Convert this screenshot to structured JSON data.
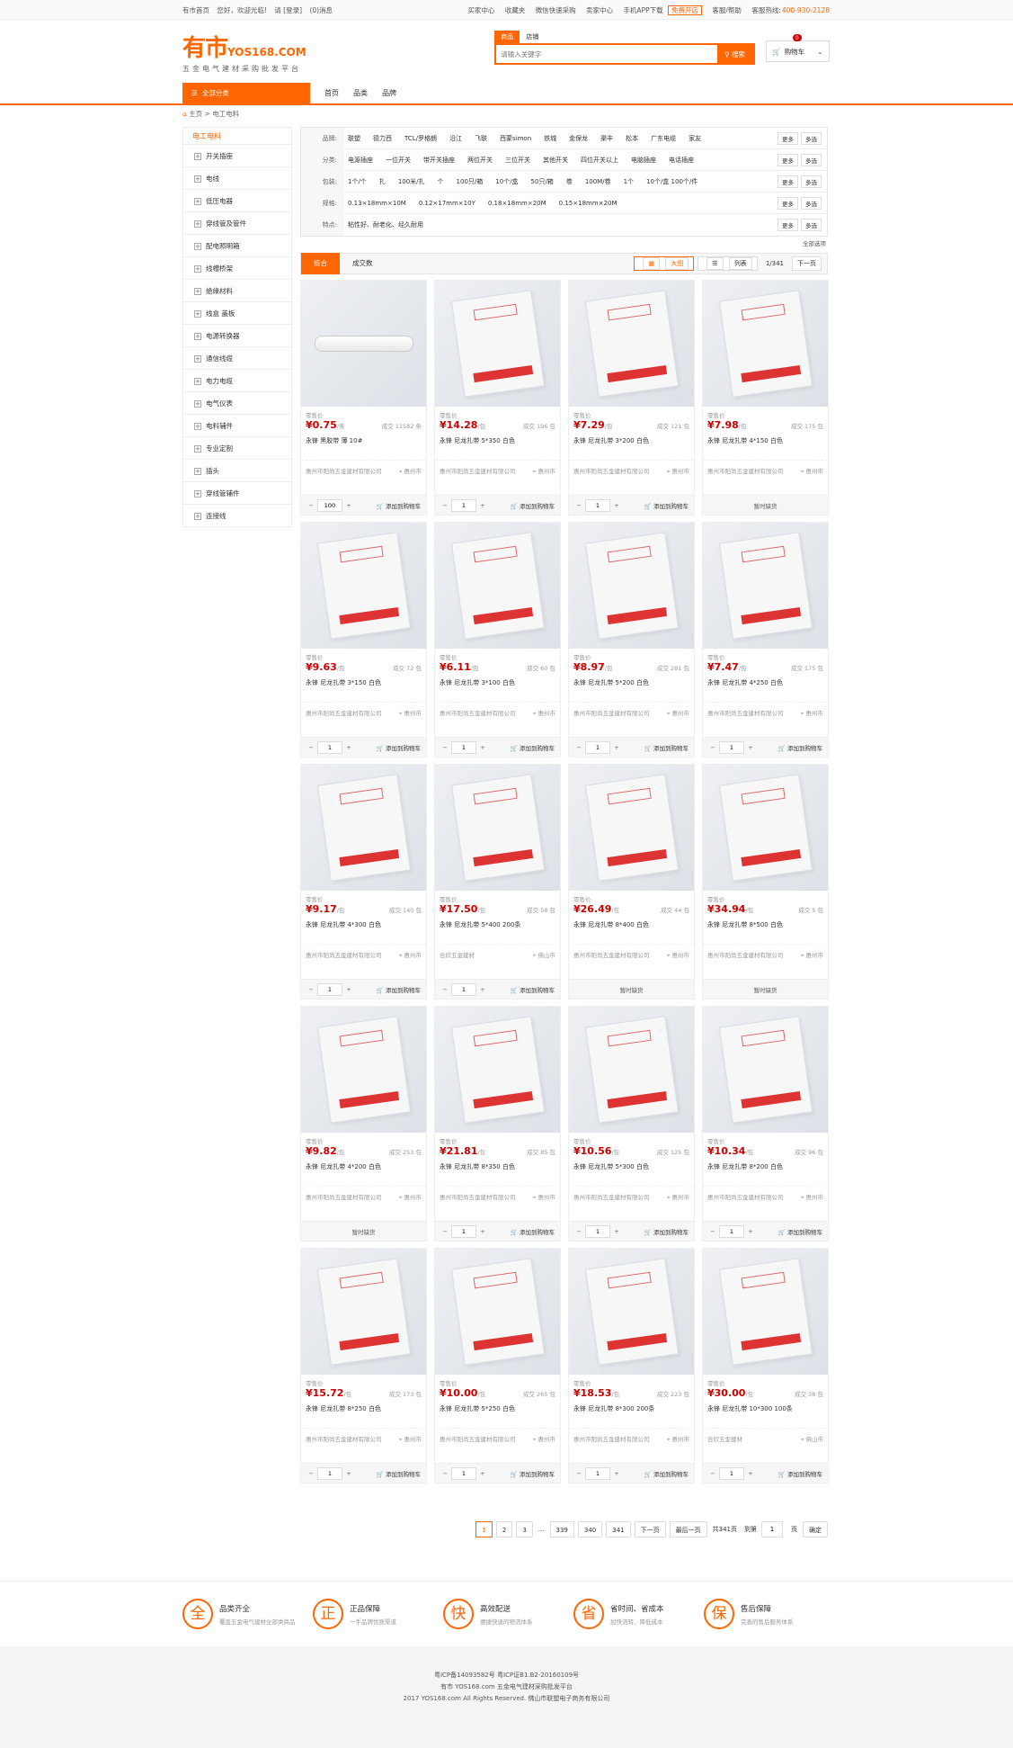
{
  "topbar": {
    "home": "有市首页",
    "welcome": "您好，欢迎光临!",
    "login": "请 [登录]",
    "msg": "(0)消息",
    "buyer": "买家中心",
    "fav": "收藏夹",
    "wechat": "微信快速采购",
    "seller": "卖家中心",
    "app": "手机APP下载",
    "open": "免费开店",
    "help": "客服/帮助",
    "hotline_label": "客服热线:",
    "hotline": "400-930-2128"
  },
  "logo": {
    "cn": "有市",
    "en": "YOS168.COM",
    "slogan": "五金电气建材采购批发平台"
  },
  "search": {
    "tab1": "商品",
    "tab2": "店铺",
    "placeholder": "请输入关键字",
    "button": "搜索"
  },
  "cart": {
    "count": "0",
    "label": "购物车"
  },
  "nav": {
    "all": "全部分类",
    "home": "首页",
    "cat": "品类",
    "brand": "品牌"
  },
  "crumb": "主页 > 电工电料",
  "side": {
    "title": "电工电料",
    "items": [
      "开关插座",
      "电线",
      "低压电器",
      "穿线管及管件",
      "配电照明箱",
      "线槽桥架",
      "绝缘材料",
      "线盒 盖板",
      "电源转换器",
      "通信线缆",
      "电力电缆",
      "电气仪表",
      "电料辅件",
      "专业定制",
      "插头",
      "穿线管辅件",
      "连接线"
    ]
  },
  "filters": [
    {
      "k": "品牌:",
      "v": [
        "联塑",
        "德力西",
        "TCL/罗格朗",
        "沿江",
        "飞联",
        "西蒙simon",
        "铁城",
        "金保龙",
        "渠丰",
        "松本",
        "广东电缆",
        "家友"
      ]
    },
    {
      "k": "分类:",
      "v": [
        "电源插座",
        "一位开关",
        "带开关插座",
        "两位开关",
        "三位开关",
        "其他开关",
        "四位开关以上",
        "电脑插座",
        "电话插座"
      ]
    },
    {
      "k": "包装:",
      "v": [
        "1个/个",
        "扎",
        "100米/扎",
        "个",
        "100只/箱",
        "10个/盒",
        "50只/箱",
        "卷",
        "100M/卷",
        "1个",
        "10个/盒 100个/件"
      ]
    },
    {
      "k": "规格:",
      "v": [
        "0.13×18mm×10M",
        "0.12×17mm×10Y",
        "0.18×18mm×20M",
        "0.15×18mm×20M"
      ]
    },
    {
      "k": "特点:",
      "v": [
        "粘性好、耐老化、经久耐用"
      ]
    }
  ],
  "filter_more": "更多",
  "filter_multi": "多选",
  "all_options": "全部选项",
  "sort": {
    "s1": "综合",
    "s2": "成交数",
    "big": "大图",
    "list": "列表",
    "page": "1/341",
    "next": "下一页"
  },
  "price_label": "零售价",
  "add_cart": "添加到购物车",
  "oos": "暂时缺货",
  "products": [
    {
      "p": "¥0.75",
      "u": "/条",
      "s": "成交 11582 条",
      "n": "永锋 黑胶带 薄 10#",
      "shop": "惠州市阳尚五金建材有限公司",
      "city": "惠州市",
      "q": "100",
      "type": "tube",
      "oos": false
    },
    {
      "p": "¥14.28",
      "u": "/包",
      "s": "成交 196 包",
      "n": "永锋 尼龙扎带 5*350 白色",
      "shop": "惠州市阳尚五金建材有限公司",
      "city": "惠州市",
      "q": "1",
      "oos": false
    },
    {
      "p": "¥7.29",
      "u": "/包",
      "s": "成交 121 包",
      "n": "永锋 尼龙扎带 3*200 白色",
      "shop": "惠州市阳尚五金建材有限公司",
      "city": "惠州市",
      "q": "1",
      "oos": false
    },
    {
      "p": "¥7.98",
      "u": "/包",
      "s": "成交 175 包",
      "n": "永锋 尼龙扎带 4*150 白色",
      "shop": "惠州市阳尚五金建材有限公司",
      "city": "惠州市",
      "q": "",
      "oos": true
    },
    {
      "p": "¥9.63",
      "u": "/包",
      "s": "成交 72 包",
      "n": "永锋 尼龙扎带 3*150 白色",
      "shop": "惠州市阳尚五金建材有限公司",
      "city": "惠州市",
      "q": "1",
      "oos": false
    },
    {
      "p": "¥6.11",
      "u": "/包",
      "s": "成交 60 包",
      "n": "永锋 尼龙扎带 3*100 白色",
      "shop": "惠州市阳尚五金建材有限公司",
      "city": "惠州市",
      "q": "1",
      "oos": false
    },
    {
      "p": "¥8.97",
      "u": "/包",
      "s": "成交 281 包",
      "n": "永锋 尼龙扎带 5*200 白色",
      "shop": "惠州市阳尚五金建材有限公司",
      "city": "惠州市",
      "q": "1",
      "oos": false
    },
    {
      "p": "¥7.47",
      "u": "/包",
      "s": "成交 175 包",
      "n": "永锋 尼龙扎带 4*250 白色",
      "shop": "惠州市阳尚五金建材有限公司",
      "city": "惠州市",
      "q": "1",
      "oos": false
    },
    {
      "p": "¥9.17",
      "u": "/包",
      "s": "成交 140 包",
      "n": "永锋 尼龙扎带 4*300 白色",
      "shop": "惠州市阳尚五金建材有限公司",
      "city": "惠州市",
      "q": "1",
      "oos": false
    },
    {
      "p": "¥17.50",
      "u": "/包",
      "s": "成交 58 包",
      "n": "永锋 尼龙扎带 5*400 200条",
      "shop": "合欣五金建材",
      "city": "佛山市",
      "q": "1",
      "oos": false
    },
    {
      "p": "¥26.49",
      "u": "/包",
      "s": "成交 44 包",
      "n": "永锋 尼龙扎带 8*400 白色",
      "shop": "惠州市阳尚五金建材有限公司",
      "city": "惠州市",
      "q": "",
      "oos": true
    },
    {
      "p": "¥34.94",
      "u": "/包",
      "s": "成交 5 包",
      "n": "永锋 尼龙扎带 8*500 白色",
      "shop": "惠州市阳尚五金建材有限公司",
      "city": "惠州市",
      "q": "",
      "oos": true
    },
    {
      "p": "¥9.82",
      "u": "/包",
      "s": "成交 253 包",
      "n": "永锋 尼龙扎带 4*200 白色",
      "shop": "惠州市阳尚五金建材有限公司",
      "city": "惠州市",
      "q": "",
      "oos": true
    },
    {
      "p": "¥21.81",
      "u": "/包",
      "s": "成交 85 包",
      "n": "永锋 尼龙扎带 8*350 白色",
      "shop": "惠州市阳尚五金建材有限公司",
      "city": "惠州市",
      "q": "1",
      "oos": false
    },
    {
      "p": "¥10.56",
      "u": "/包",
      "s": "成交 125 包",
      "n": "永锋 尼龙扎带 5*300 白色",
      "shop": "惠州市阳尚五金建材有限公司",
      "city": "惠州市",
      "q": "1",
      "oos": false
    },
    {
      "p": "¥10.34",
      "u": "/包",
      "s": "成交 96 包",
      "n": "永锋 尼龙扎带 8*200 白色",
      "shop": "惠州市阳尚五金建材有限公司",
      "city": "惠州市",
      "q": "1",
      "oos": false
    },
    {
      "p": "¥15.72",
      "u": "/包",
      "s": "成交 173 包",
      "n": "永锋 尼龙扎带 8*250 白色",
      "shop": "惠州市阳尚五金建材有限公司",
      "city": "惠州市",
      "q": "1",
      "oos": false
    },
    {
      "p": "¥10.00",
      "u": "/包",
      "s": "成交 265 包",
      "n": "永锋 尼龙扎带 5*250 白色",
      "shop": "惠州市阳尚五金建材有限公司",
      "city": "惠州市",
      "q": "1",
      "oos": false
    },
    {
      "p": "¥18.53",
      "u": "/包",
      "s": "成交 223 包",
      "n": "永锋 尼龙扎带 8*300 200条",
      "shop": "惠州市阳尚五金建材有限公司",
      "city": "惠州市",
      "q": "1",
      "oos": false
    },
    {
      "p": "¥30.00",
      "u": "/包",
      "s": "成交 38 包",
      "n": "永锋 尼龙扎带 10*300 100条",
      "shop": "合欣五金建材",
      "city": "佛山市",
      "q": "1",
      "oos": false
    }
  ],
  "pager": {
    "p1": "1",
    "p2": "2",
    "p3": "3",
    "dots": "...",
    "p339": "339",
    "p340": "340",
    "p341": "341",
    "next": "下一页",
    "last": "最后一页",
    "total": "共341页",
    "goto": "到第",
    "page": "页",
    "value": "1",
    "ok": "确定"
  },
  "services": [
    {
      "ic": "全",
      "t": "品类齐全",
      "d": "覆盖五金电气建材全部类商品"
    },
    {
      "ic": "正",
      "t": "正品保障",
      "d": "一手品牌优质渠道"
    },
    {
      "ic": "快",
      "t": "高效配送",
      "d": "便捷快速的物流体系"
    },
    {
      "ic": "省",
      "t": "省时间、省成本",
      "d": "加快流转、降低成本"
    },
    {
      "ic": "保",
      "t": "售后保障",
      "d": "完善的售后服务体系"
    }
  ],
  "footer": {
    "l1": "粤ICP备14093582号 粤ICP证B1.B2-20160109号",
    "l2": "有市 YOS168.com 五金电气建材采购批发平台",
    "l3": "2017 YOS168.com All Rights Reserved. 佛山市联塑电子商务有限公司"
  },
  "colors": {
    "accent": "#ff6600",
    "price": "#cc0000"
  }
}
